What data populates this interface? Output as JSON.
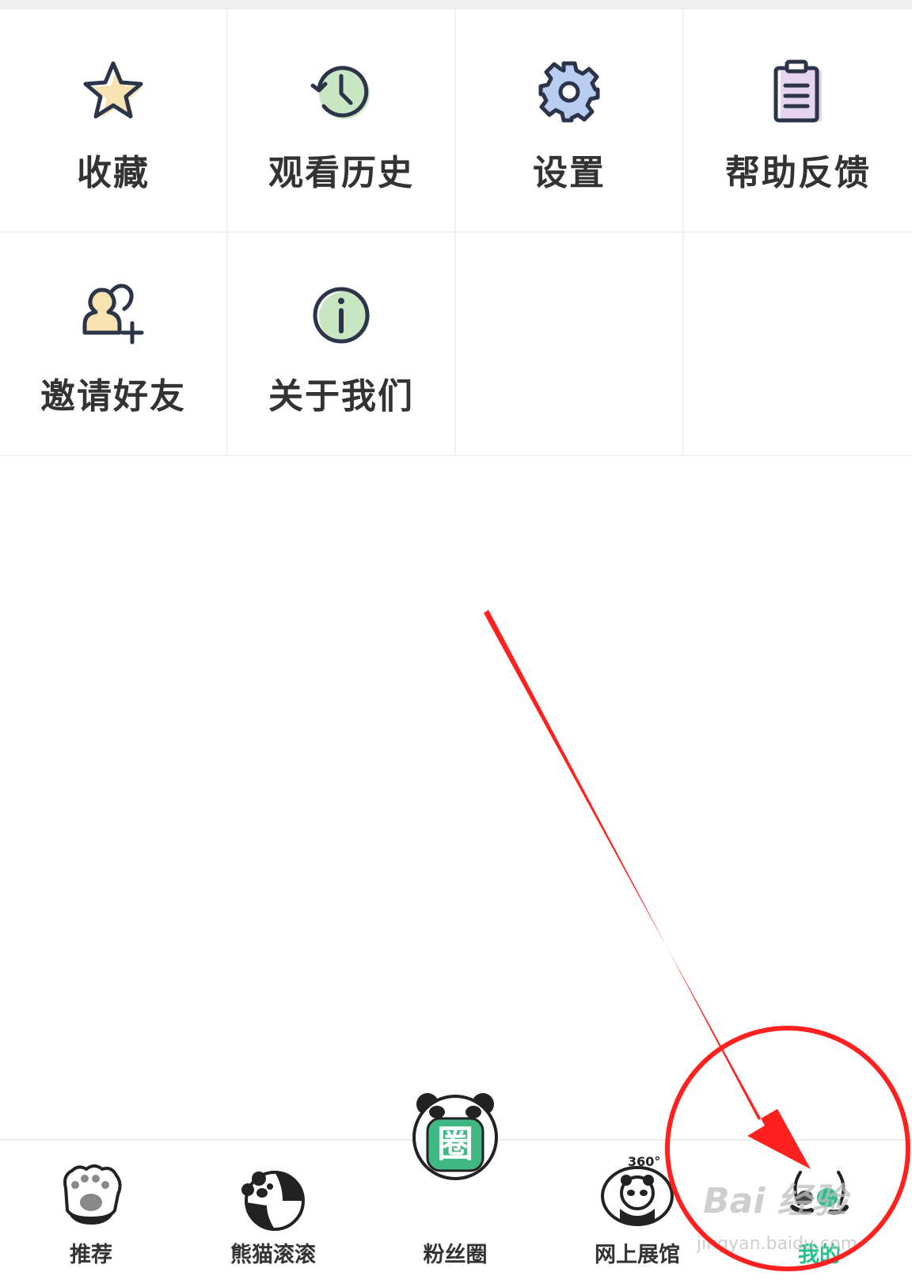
{
  "menu": {
    "items": [
      {
        "label": "收藏",
        "icon": "star-icon"
      },
      {
        "label": "观看历史",
        "icon": "history-clock-icon"
      },
      {
        "label": "设置",
        "icon": "gear-icon"
      },
      {
        "label": "帮助反馈",
        "icon": "clipboard-icon"
      },
      {
        "label": "邀请好友",
        "icon": "add-user-icon"
      },
      {
        "label": "关于我们",
        "icon": "info-icon"
      }
    ]
  },
  "nav": {
    "items": [
      {
        "label": "推荐",
        "icon": "panda-paw-icon"
      },
      {
        "label": "熊猫滚滚",
        "icon": "rolling-panda-icon"
      },
      {
        "label": "粉丝圈",
        "icon": "panda-fan-circle-icon"
      },
      {
        "label": "网上展馆",
        "icon": "panda-360-icon"
      },
      {
        "label": "我的",
        "icon": "panda-profile-icon",
        "active": true
      }
    ]
  },
  "watermark": {
    "line1": "Bai 经验",
    "line2": "jingyan.baidu.com"
  },
  "colors": {
    "accent": "#23c08a",
    "annotation": "#ff2020",
    "text": "#333333"
  }
}
